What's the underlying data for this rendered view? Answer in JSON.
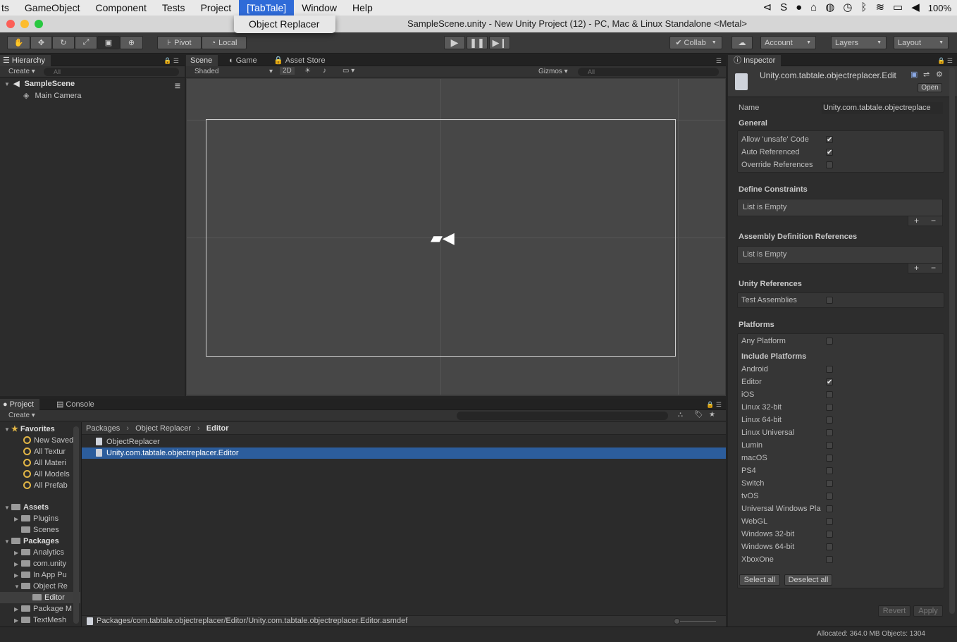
{
  "menubar": {
    "items": [
      "ts",
      "GameObject",
      "Component",
      "Tests",
      "Project",
      "[TabTale]",
      "Window",
      "Help"
    ],
    "active_index": 5,
    "battery": "100%"
  },
  "dropdown": {
    "item": "Object Replacer"
  },
  "window": {
    "title": "SampleScene.unity - New Unity Project (12) - PC, Mac & Linux Standalone <Metal>"
  },
  "toolbar": {
    "pivot": "Pivot",
    "local": "Local",
    "collab": "Collab",
    "account": "Account",
    "layers": "Layers",
    "layout": "Layout"
  },
  "hierarchy": {
    "tab": "Hierarchy",
    "create": "Create",
    "search_placeholder": "All",
    "scene": "SampleScene",
    "objects": [
      "Main Camera"
    ]
  },
  "scene": {
    "tabs": [
      "Scene",
      "Game",
      "Asset Store"
    ],
    "shading": "Shaded",
    "mode_2d": "2D",
    "gizmos": "Gizmos",
    "search_placeholder": "All"
  },
  "project": {
    "tabs": [
      "Project",
      "Console"
    ],
    "create": "Create",
    "favorites_header": "Favorites",
    "favorites": [
      "New Saved",
      "All Textur",
      "All Materi",
      "All Models",
      "All Prefab"
    ],
    "assets_header": "Assets",
    "assets": [
      "Plugins",
      "Scenes"
    ],
    "packages_header": "Packages",
    "packages": [
      "Analytics",
      "com.unity",
      "In App Pu",
      "Object Re",
      "Editor",
      "Package M",
      "TextMesh"
    ],
    "breadcrumb": [
      "Packages",
      "Object Replacer",
      "Editor"
    ],
    "files": [
      "ObjectReplacer",
      "Unity.com.tabtale.objectreplacer.Editor"
    ],
    "path": "Packages/com.tabtale.objectreplacer/Editor/Unity.com.tabtale.objectreplacer.Editor.asmdef"
  },
  "inspector": {
    "tab": "Inspector",
    "asset_title": "Unity.com.tabtale.objectreplacer.Edit",
    "open": "Open",
    "name_label": "Name",
    "name_value": "Unity.com.tabtale.objectreplace",
    "general": "General",
    "general_options": [
      {
        "label": "Allow 'unsafe' Code",
        "checked": true
      },
      {
        "label": "Auto Referenced",
        "checked": true
      },
      {
        "label": "Override References",
        "checked": false
      }
    ],
    "define_constraints": "Define Constraints",
    "list_empty": "List is Empty",
    "assembly_refs": "Assembly Definition References",
    "unity_refs": "Unity References",
    "test_assemblies": "Test Assemblies",
    "platforms": "Platforms",
    "any_platform": "Any Platform",
    "include_platforms": "Include Platforms",
    "platform_list": [
      {
        "label": "Android",
        "checked": false
      },
      {
        "label": "Editor",
        "checked": true
      },
      {
        "label": "iOS",
        "checked": false
      },
      {
        "label": "Linux 32-bit",
        "checked": false
      },
      {
        "label": "Linux 64-bit",
        "checked": false
      },
      {
        "label": "Linux Universal",
        "checked": false
      },
      {
        "label": "Lumin",
        "checked": false
      },
      {
        "label": "macOS",
        "checked": false
      },
      {
        "label": "PS4",
        "checked": false
      },
      {
        "label": "Switch",
        "checked": false
      },
      {
        "label": "tvOS",
        "checked": false
      },
      {
        "label": "Universal Windows Pla",
        "checked": false
      },
      {
        "label": "WebGL",
        "checked": false
      },
      {
        "label": "Windows 32-bit",
        "checked": false
      },
      {
        "label": "Windows 64-bit",
        "checked": false
      },
      {
        "label": "XboxOne",
        "checked": false
      }
    ],
    "select_all": "Select all",
    "deselect_all": "Deselect all",
    "revert": "Revert",
    "apply": "Apply"
  },
  "statusbar": {
    "text": "Allocated: 364.0 MB Objects: 1304"
  }
}
